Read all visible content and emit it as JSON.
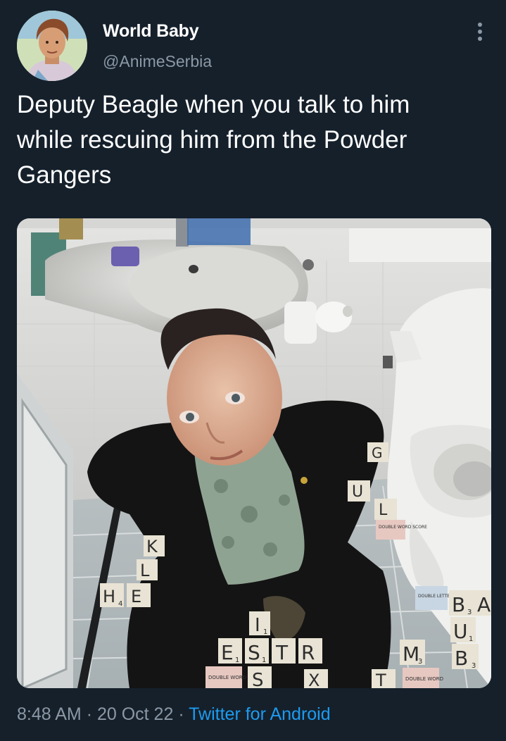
{
  "tweet": {
    "display_name": "World Baby",
    "handle": "@AnimeSerbia",
    "text": "Deputy Beagle when you talk to him\nwhile rescuing him from the Powder\nGangers",
    "time": "8:48 AM",
    "separator": "·",
    "date": "20 Oct 22",
    "source": "Twitter for Android"
  },
  "icons": {
    "more": "more-vertical-icon"
  },
  "tiles": {
    "t1": "K",
    "t2": "L",
    "t3": "H",
    "t3s": "4",
    "t4": "E",
    "t5": "G",
    "t6": "U",
    "t7": "L",
    "t8": "E",
    "t8s": "1",
    "t9": "S",
    "t9s": "1",
    "t10": "T",
    "t11": "R",
    "t12": "I",
    "t12s": "1",
    "t13": "S",
    "t14": "X",
    "t15": "T",
    "t16": "M",
    "t16s": "3",
    "t17": "B",
    "t17s": "3",
    "t18": "U",
    "t18s": "1",
    "t19": "B",
    "t19s": "3",
    "t20": "A",
    "sq1": "DOUBLE WORD SCORE",
    "sq2": "DOUBLE LETTER SCORE",
    "sq3": "DOUBLE WORD",
    "sq4": "DOUBLE WORD"
  },
  "colors": {
    "background": "#15202b",
    "text": "#ffffff",
    "secondary": "#8b98a5",
    "link": "#1d9bf0"
  }
}
